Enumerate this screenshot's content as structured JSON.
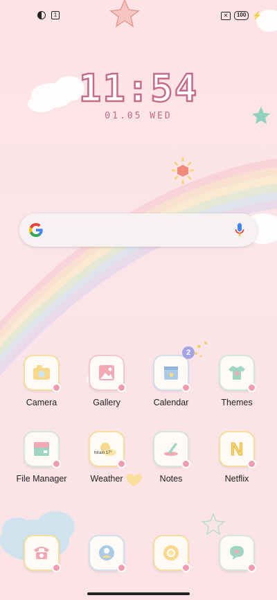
{
  "status_bar": {
    "battery": "100",
    "left_icons": [
      "data-saver-icon",
      "sim-icon"
    ],
    "right_icons": [
      "no-sim-icon",
      "battery-icon",
      "charging-icon"
    ]
  },
  "clock": {
    "time": "11:54",
    "date": "01.05  WED"
  },
  "search": {
    "left_icon": "google-logo-icon",
    "right_icon": "mic-icon"
  },
  "apps_row1": [
    {
      "label": "Camera",
      "icon": "camera-icon"
    },
    {
      "label": "Gallery",
      "icon": "gallery-icon"
    },
    {
      "label": "Calendar",
      "icon": "calendar-icon",
      "badge": "2"
    },
    {
      "label": "Themes",
      "icon": "shirt-icon"
    }
  ],
  "apps_row2": [
    {
      "label": "File Manager",
      "icon": "folder-icon"
    },
    {
      "label": "Weather",
      "icon": "weather-icon",
      "widget_text": "htrain 17°"
    },
    {
      "label": "Notes",
      "icon": "notes-icon"
    },
    {
      "label": "Netflix",
      "icon": "netflix-icon",
      "glyph": "N"
    }
  ],
  "dock": [
    {
      "icon": "phone-icon"
    },
    {
      "icon": "contacts-icon"
    },
    {
      "icon": "chrome-icon"
    },
    {
      "icon": "messages-icon"
    }
  ],
  "colors": {
    "background": "#fce4e6",
    "clock_outline": "#c76a8a",
    "badge": "#a5a3e6"
  }
}
